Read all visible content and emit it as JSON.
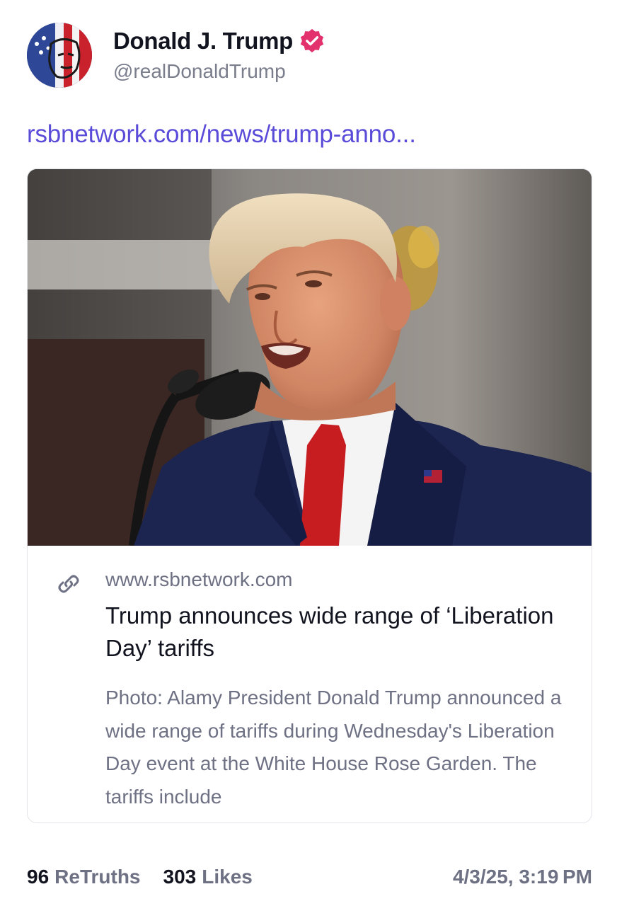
{
  "author": {
    "display_name": "Donald J. Trump",
    "handle": "@realDonaldTrump",
    "verified": true,
    "verified_badge_color": "#e1306c",
    "avatar_icon": "flag-face-avatar"
  },
  "post": {
    "link_text": "rsbnetwork.com/news/trump-anno...",
    "link_color": "#5a4bd9"
  },
  "link_card": {
    "image_alt": "President Donald Trump speaking at a microphone",
    "icon": "link-icon",
    "domain": "www.rsbnetwork.com",
    "title": "Trump announces wide range of ‘Liberation Day’ tariffs",
    "description": "Photo: Alamy President Donald Trump announced a wide range of tariffs during Wednesday's Liberation Day event at the White House Rose Garden. The tariffs include"
  },
  "stats": {
    "retruths_count": "96",
    "retruths_label": "ReTruths",
    "likes_count": "303",
    "likes_label": "Likes",
    "timestamp": "4/3/25, 3:19 PM"
  }
}
